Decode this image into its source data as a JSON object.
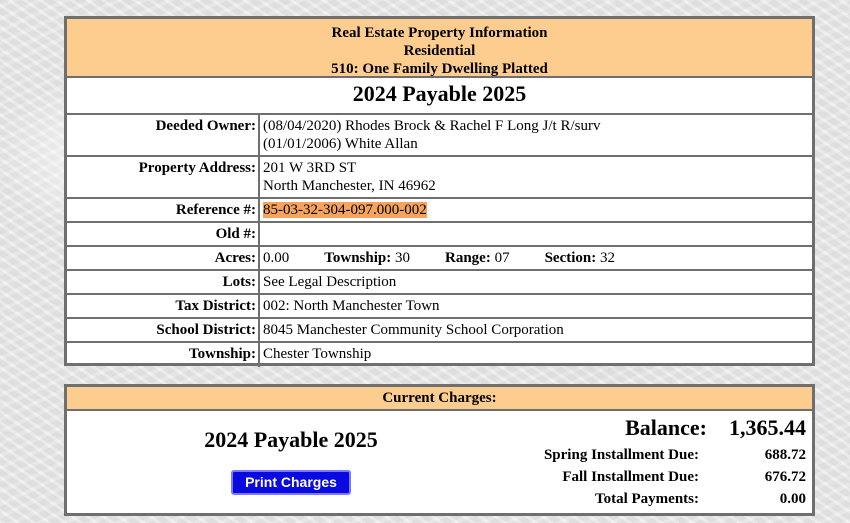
{
  "info": {
    "header": [
      "Real Estate Property Information",
      "Residential",
      "510: One Family Dwelling Platted"
    ],
    "year_title": "2024 Payable 2025",
    "deeded_owner": {
      "label": "Deeded Owner:",
      "lines": [
        "(08/04/2020) Rhodes Brock & Rachel F Long J/t R/surv",
        "(01/01/2006) White Allan"
      ]
    },
    "property_address": {
      "label": "Property Address:",
      "lines": [
        "201 W 3RD ST",
        "North Manchester, IN 46962"
      ]
    },
    "reference": {
      "label": "Reference #:",
      "value": "85-03-32-304-097.000-002"
    },
    "old": {
      "label": "Old #:",
      "value": ""
    },
    "acres": {
      "label": "Acres:",
      "value": "0.00",
      "township_label": "Township:",
      "township": "30",
      "range_label": "Range:",
      "range": "07",
      "section_label": "Section:",
      "section": "32"
    },
    "lots": {
      "label": "Lots:",
      "value": "See Legal Description"
    },
    "tax_district": {
      "label": "Tax District:",
      "value": "002: North Manchester Town"
    },
    "school_district": {
      "label": "School District:",
      "value": "8045 Manchester Community School Corporation"
    },
    "township": {
      "label": "Township:",
      "value": "Chester Township"
    }
  },
  "charges": {
    "header": "Current Charges:",
    "year_title": "2024 Payable 2025",
    "print_label": "Print Charges",
    "balance_label": "Balance:",
    "balance": "1,365.44",
    "spring_label": "Spring Installment Due:",
    "spring": "688.72",
    "fall_label": "Fall Installment Due:",
    "fall": "676.72",
    "payments_label": "Total Payments:",
    "payments": "0.00"
  },
  "colors": {
    "header_bg": "#fdcc8f",
    "highlight": "#f5a45d",
    "button": "#0a0ae0"
  }
}
